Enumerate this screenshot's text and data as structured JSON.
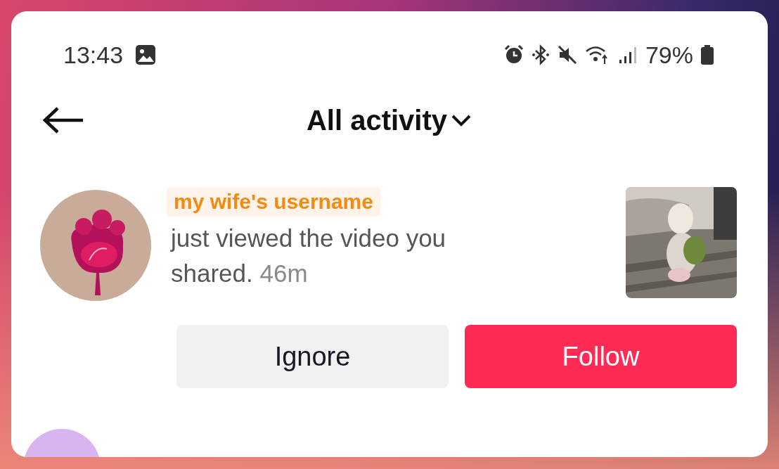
{
  "status_bar": {
    "time": "13:43",
    "battery_percent": "79%"
  },
  "header": {
    "title": "All activity"
  },
  "notifications": [
    {
      "username": "my wife's username",
      "message": "just viewed the video you shared.",
      "time": "46m",
      "buttons": [
        {
          "label": "Ignore",
          "kind": "secondary"
        },
        {
          "label": "Follow",
          "kind": "primary"
        }
      ]
    }
  ]
}
